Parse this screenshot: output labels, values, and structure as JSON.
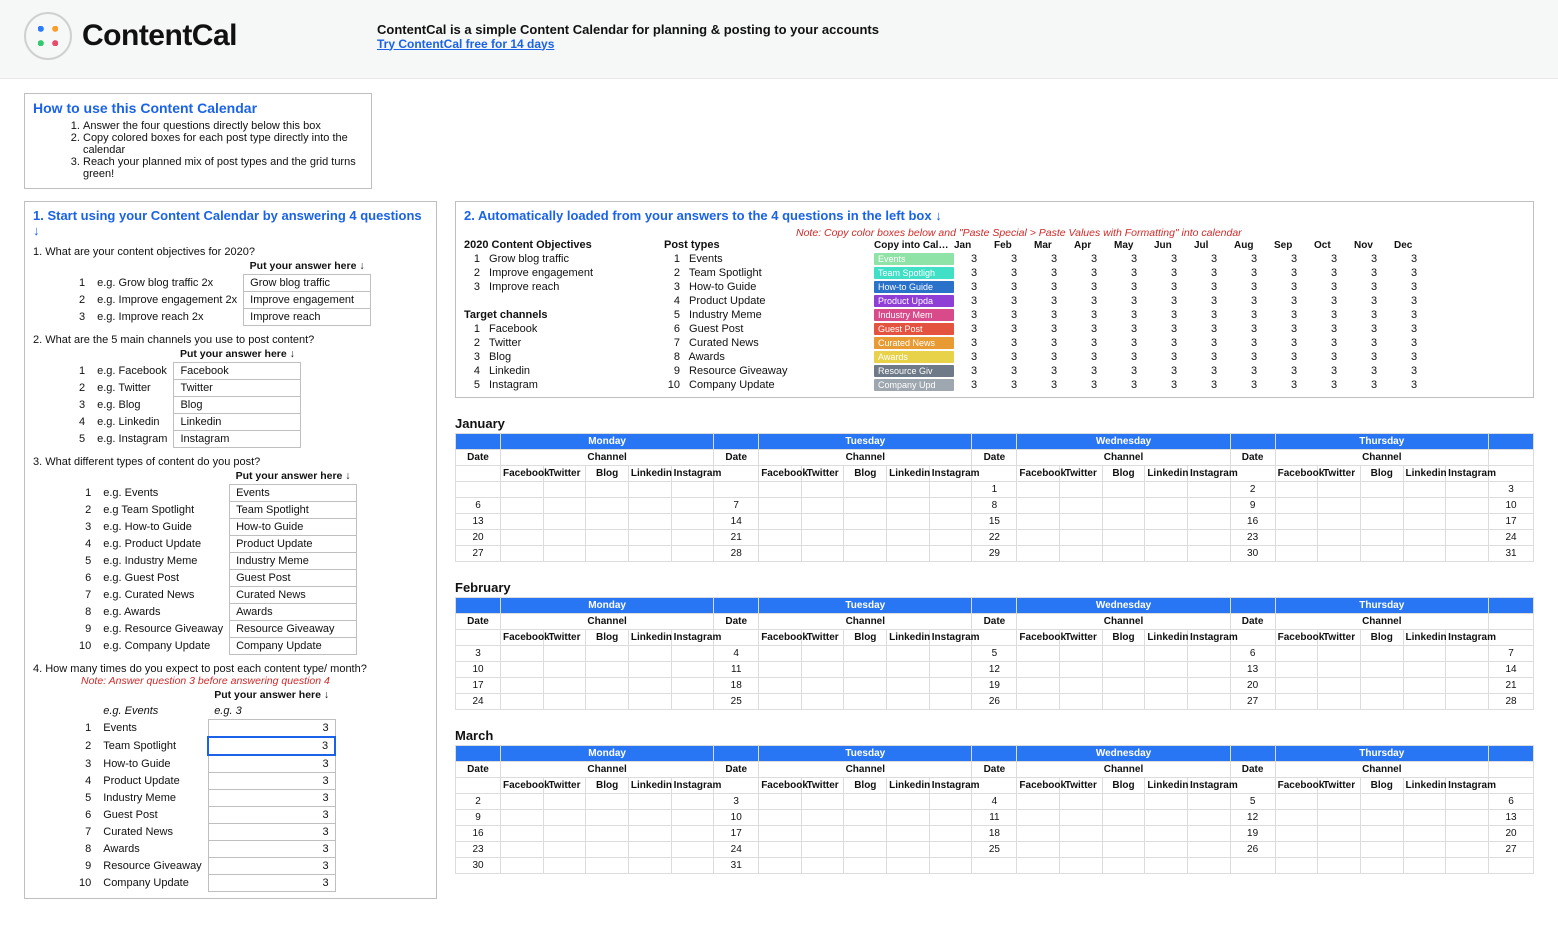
{
  "header": {
    "wordmark": "ContentCal",
    "tagline": "ContentCal is a simple Content Calendar for planning & posting to your accounts",
    "trial_link": "Try ContentCal free for 14 days"
  },
  "howto": {
    "title": "How to use this Content Calendar",
    "steps": [
      "Answer the four questions directly below this box",
      "Copy colored boxes for each post type directly into the calendar",
      "Reach your planned mix of post types and the grid turns green!"
    ]
  },
  "left": {
    "title": "1. Start using your Content Calendar by answering 4 questions ↓",
    "q1": {
      "prompt": "1. What are your content objectives for 2020?",
      "hint": "Put your answer here ↓",
      "rows": [
        {
          "n": "1",
          "eg": "e.g. Grow blog traffic 2x",
          "val": "Grow blog traffic"
        },
        {
          "n": "2",
          "eg": "e.g. Improve engagement 2x",
          "val": "Improve engagement"
        },
        {
          "n": "3",
          "eg": "e.g. Improve reach 2x",
          "val": "Improve reach"
        }
      ]
    },
    "q2": {
      "prompt": "2. What are the 5 main channels you use to post content?",
      "hint": "Put your answer here ↓",
      "rows": [
        {
          "n": "1",
          "eg": "e.g. Facebook",
          "val": "Facebook"
        },
        {
          "n": "2",
          "eg": "e.g. Twitter",
          "val": "Twitter"
        },
        {
          "n": "3",
          "eg": "e.g. Blog",
          "val": "Blog"
        },
        {
          "n": "4",
          "eg": "e.g. Linkedin",
          "val": "Linkedin"
        },
        {
          "n": "5",
          "eg": "e.g. Instagram",
          "val": "Instagram"
        }
      ]
    },
    "q3": {
      "prompt": "3. What different types of content do you post?",
      "hint": "Put your answer here ↓",
      "rows": [
        {
          "n": "1",
          "eg": "e.g. Events",
          "val": "Events"
        },
        {
          "n": "2",
          "eg": "e.g Team Spotlight",
          "val": "Team Spotlight"
        },
        {
          "n": "3",
          "eg": "e.g. How-to Guide",
          "val": "How-to Guide"
        },
        {
          "n": "4",
          "eg": "e.g. Product Update",
          "val": "Product Update"
        },
        {
          "n": "5",
          "eg": "e.g. Industry Meme",
          "val": "Industry Meme"
        },
        {
          "n": "6",
          "eg": "e.g. Guest Post",
          "val": "Guest Post"
        },
        {
          "n": "7",
          "eg": "e.g. Curated News",
          "val": "Curated News"
        },
        {
          "n": "8",
          "eg": "e.g. Awards",
          "val": "Awards"
        },
        {
          "n": "9",
          "eg": "e.g. Resource Giveaway",
          "val": "Resource Giveaway"
        },
        {
          "n": "10",
          "eg": "e.g. Company Update",
          "val": "Company Update"
        }
      ]
    },
    "q4": {
      "prompt": "4. How many times do you expect to post each content type/ month?",
      "note": "Note: Answer question 3 before answering question 4",
      "hint": "Put your answer here ↓",
      "eg_label": "e.g. Events",
      "eg_val": "e.g. 3",
      "rows": [
        {
          "n": "1",
          "name": "Events",
          "val": "3"
        },
        {
          "n": "2",
          "name": "Team Spotlight",
          "val": "3",
          "selected": true
        },
        {
          "n": "3",
          "name": "How-to Guide",
          "val": "3"
        },
        {
          "n": "4",
          "name": "Product Update",
          "val": "3"
        },
        {
          "n": "5",
          "name": "Industry Meme",
          "val": "3"
        },
        {
          "n": "6",
          "name": "Guest Post",
          "val": "3"
        },
        {
          "n": "7",
          "name": "Curated News",
          "val": "3"
        },
        {
          "n": "8",
          "name": "Awards",
          "val": "3"
        },
        {
          "n": "9",
          "name": "Resource Giveaway",
          "val": "3"
        },
        {
          "n": "10",
          "name": "Company Update",
          "val": "3"
        }
      ]
    }
  },
  "right": {
    "title": "2. Automatically loaded from your answers to the 4 questions in the left box ↓",
    "note": "Note: Copy color boxes below and \"Paste Special > Paste Values with Formatting\" into calendar",
    "headers": {
      "objectives": "2020 Content Objectives",
      "post_types": "Post types",
      "copy": "Copy into Calendar ↓",
      "target_channels": "Target channels"
    },
    "months": [
      "Jan",
      "Feb",
      "Mar",
      "Apr",
      "May",
      "Jun",
      "Jul",
      "Aug",
      "Sep",
      "Oct",
      "Nov",
      "Dec"
    ],
    "monthly_value": "3",
    "objectives": [
      {
        "n": "1",
        "label": "Grow blog traffic"
      },
      {
        "n": "2",
        "label": "Improve engagement"
      },
      {
        "n": "3",
        "label": "Improve reach"
      }
    ],
    "channels": [
      {
        "n": "1",
        "label": "Facebook"
      },
      {
        "n": "2",
        "label": "Twitter"
      },
      {
        "n": "3",
        "label": "Blog"
      },
      {
        "n": "4",
        "label": "Linkedin"
      },
      {
        "n": "5",
        "label": "Instagram"
      }
    ],
    "post_types": [
      {
        "n": "1",
        "label": "Events",
        "chip": "Events",
        "color": "#8fe3a6"
      },
      {
        "n": "2",
        "label": "Team Spotlight",
        "chip": "Team Spotligh",
        "color": "#3fe0c5"
      },
      {
        "n": "3",
        "label": "How-to Guide",
        "chip": "How-to Guide",
        "color": "#2a72c9"
      },
      {
        "n": "4",
        "label": "Product Update",
        "chip": "Product Upda",
        "color": "#8f3fd6"
      },
      {
        "n": "5",
        "label": "Industry Meme",
        "chip": "Industry Mem",
        "color": "#d94a8a"
      },
      {
        "n": "6",
        "label": "Guest Post",
        "chip": "Guest Post",
        "color": "#e3533f"
      },
      {
        "n": "7",
        "label": "Curated News",
        "chip": "Curated News",
        "color": "#e89a33"
      },
      {
        "n": "8",
        "label": "Awards",
        "chip": "Awards",
        "color": "#e8d24a"
      },
      {
        "n": "9",
        "label": "Resource Giveaway",
        "chip": "Resource Giv",
        "color": "#6e7a88"
      },
      {
        "n": "10",
        "label": "Company Update",
        "chip": "Company Upd",
        "color": "#9ea7af"
      }
    ]
  },
  "calendar": {
    "days": [
      "Monday",
      "Tuesday",
      "Wednesday",
      "Thursday"
    ],
    "channels": [
      "Facebook",
      "Twitter",
      "Blog",
      "Linkedin",
      "Instagram"
    ],
    "date_hdr": "Date",
    "channel_hdr": "Channel",
    "months": [
      {
        "name": "January",
        "weeks": [
          {
            "cells": [
              "",
              "",
              "1",
              "2",
              "3"
            ]
          },
          {
            "cells": [
              "6",
              "7",
              "8",
              "9",
              "10"
            ]
          },
          {
            "cells": [
              "13",
              "14",
              "15",
              "16",
              "17"
            ]
          },
          {
            "cells": [
              "20",
              "21",
              "22",
              "23",
              "24"
            ]
          },
          {
            "cells": [
              "27",
              "28",
              "29",
              "30",
              "31"
            ]
          }
        ]
      },
      {
        "name": "February",
        "weeks": [
          {
            "cells": [
              "3",
              "4",
              "5",
              "6",
              "7"
            ]
          },
          {
            "cells": [
              "10",
              "11",
              "12",
              "13",
              "14"
            ]
          },
          {
            "cells": [
              "17",
              "18",
              "19",
              "20",
              "21"
            ]
          },
          {
            "cells": [
              "24",
              "25",
              "26",
              "27",
              "28"
            ]
          }
        ]
      },
      {
        "name": "March",
        "weeks": [
          {
            "cells": [
              "2",
              "3",
              "4",
              "5",
              "6"
            ]
          },
          {
            "cells": [
              "9",
              "10",
              "11",
              "12",
              "13"
            ]
          },
          {
            "cells": [
              "16",
              "17",
              "18",
              "19",
              "20"
            ]
          },
          {
            "cells": [
              "23",
              "24",
              "25",
              "26",
              "27"
            ]
          },
          {
            "cells": [
              "30",
              "31",
              "",
              "",
              ""
            ]
          }
        ]
      }
    ]
  }
}
